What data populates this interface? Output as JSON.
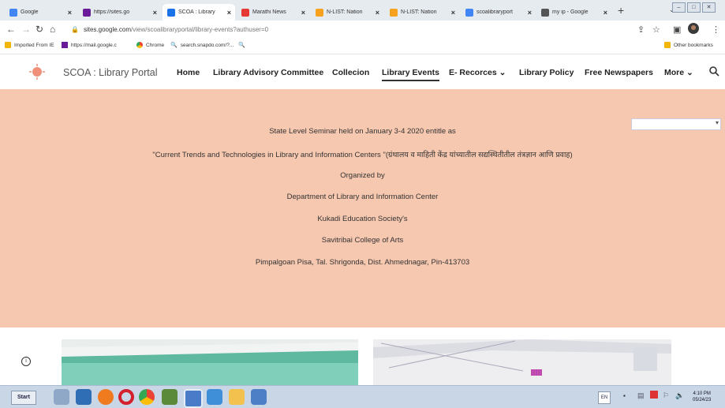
{
  "tabs": [
    {
      "label": "Google",
      "icon": "google-icon",
      "color": "#4285f4",
      "active": false
    },
    {
      "label": "https://sites.go",
      "icon": "yahoo-icon",
      "color": "#6a1b9a",
      "active": false
    },
    {
      "label": "SCOA : Library",
      "icon": "google-sites-icon",
      "color": "#1a73e8",
      "active": true
    },
    {
      "label": "Marathi News",
      "icon": "news-icon",
      "color": "#e53935",
      "active": false
    },
    {
      "label": "N-LIST: Nation",
      "icon": "nlist-icon",
      "color": "#f6a21e",
      "active": false
    },
    {
      "label": "N-LIST: Nation",
      "icon": "nlist-icon",
      "color": "#f6a21e",
      "active": false
    },
    {
      "label": "scoalibraryport",
      "icon": "google-icon",
      "color": "#4285f4",
      "active": false
    },
    {
      "label": "my ip - Google",
      "icon": "globe-icon",
      "color": "#555555",
      "active": false
    }
  ],
  "new_tab": "+",
  "address": {
    "host": "sites.google.com",
    "path": "/view/scoalibraryportal/library-events?authuser=0"
  },
  "bookmarks": [
    {
      "label": "Imported From IE",
      "icon": "folder-icon"
    },
    {
      "label": "https://mail.google.c",
      "icon": "yahoo-icon"
    },
    {
      "label": "Chrome",
      "icon": "google-icon"
    },
    {
      "label": "search.snapdo.com/?...",
      "icon": "search-icon"
    }
  ],
  "other_bookmarks": "Other bookmarks",
  "site": {
    "title": "SCOA : Library Portal",
    "nav": [
      {
        "label": "Home",
        "active": false
      },
      {
        "label": "Library Advisory Committee",
        "active": false
      },
      {
        "label": "Collecion",
        "active": false
      },
      {
        "label": "Library Events",
        "active": true
      },
      {
        "label": "E- Recorces",
        "active": false,
        "dropdown": true
      },
      {
        "label": "Library Policy",
        "active": false
      },
      {
        "label": "Free Newspapers",
        "active": false
      },
      {
        "label": "More",
        "active": false,
        "dropdown": true
      }
    ]
  },
  "banner": {
    "bg_color": "#f7c8b0",
    "lines": [
      "State Level Seminar held on January 3-4 2020 entitle as",
      "\"Current Trends and Technologies in Library and Information Centers \"(ग्रंथालय व माहिती केंद्र यांच्यातील सद्यस्थितीतील तंत्रज्ञान आणि प्रवाह)",
      "Organized by",
      "Department  of  Library and Information Center",
      "Kukadi Education Society's",
      "Savitribai College of Arts",
      "Pimpalgoan Pisa, Tal. Shrigonda, Dist. Ahmednagar, Pin-413703"
    ]
  },
  "taskbar": {
    "start_label": "Start",
    "lang": "EN",
    "time": "4:10 PM",
    "date": "05/24/23"
  }
}
